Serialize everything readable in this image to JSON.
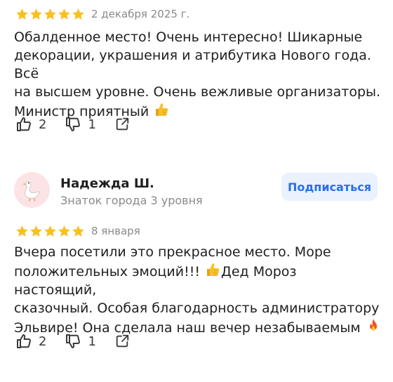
{
  "reviews": [
    {
      "rating": 5,
      "date": "2 декабря 2025 г.",
      "text_lines": [
        "Обалденное место! Очень интересно! Шикарные",
        "декорации, украшения и атрибутика Нового года. Всё",
        "на высшем уровне. Очень вежливые организаторы.",
        "Министр приятный"
      ],
      "likes": "2",
      "dislikes": "1"
    },
    {
      "author": {
        "name": "Надежда Ш.",
        "level": "Знаток города 3 уровня",
        "avatar_icon": "goose-icon"
      },
      "subscribe_label": "Подписаться",
      "rating": 5,
      "date": "8 января",
      "text_lines": [
        "Вчера посетили это прекрасное место. Море",
        "положительных эмоций!!! ",
        "сказочный. Особая благодарность администратору",
        "Эльвире! Она сделала наш вечер незабываемым"
      ],
      "text_line2_after": "Дед Мороз настоящий,",
      "likes": "2",
      "dislikes": "1"
    }
  ],
  "colors": {
    "star": "#fbbf24",
    "accent": "#2a6ee8",
    "subscribe_bg": "#eaf2fe",
    "avatar_bg": "#fbe3e6"
  },
  "icons": [
    "star-icon",
    "thumbs-up-icon",
    "thumbs-down-icon",
    "share-icon",
    "thumbs-up-emoji",
    "fire-emoji"
  ]
}
